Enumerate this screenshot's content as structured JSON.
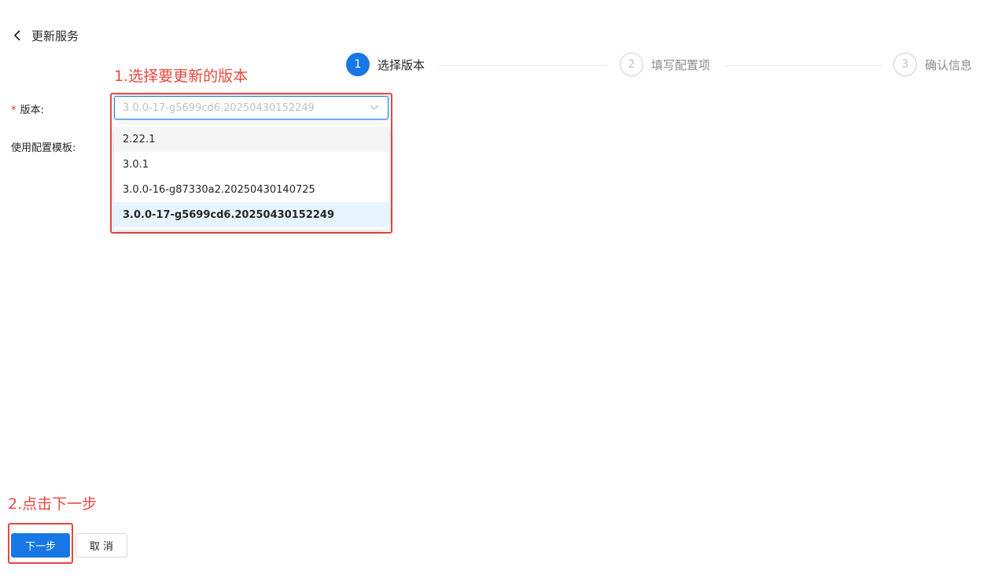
{
  "header": {
    "back_icon": "chevron-left-icon",
    "title": "更新服务"
  },
  "steps": [
    {
      "number": "1",
      "label": "选择版本",
      "state": "active"
    },
    {
      "number": "2",
      "label": "填写配置项",
      "state": "pending"
    },
    {
      "number": "3",
      "label": "确认信息",
      "state": "pending"
    }
  ],
  "annotations": {
    "step1": "1.选择要更新的版本",
    "step2": "2.点击下一步",
    "color": "#e8473d"
  },
  "form": {
    "version_required_mark": "*",
    "version_label": "版本:",
    "template_label": "使用配置模板:",
    "version_select": {
      "value": "3.0.0-17-g5699cd6.20250430152249",
      "arrow_icon": "chevron-down-icon",
      "options": [
        {
          "label": "2.22.1",
          "state": "hover"
        },
        {
          "label": "3.0.1",
          "state": "normal"
        },
        {
          "label": "3.0.0-16-g87330a2.20250430140725",
          "state": "normal"
        },
        {
          "label": "3.0.0-17-g5699cd6.20250430152249",
          "state": "selected"
        }
      ]
    }
  },
  "footer": {
    "next_label": "下一步",
    "cancel_label": "取 消"
  },
  "colors": {
    "primary": "#1677e5",
    "selected_bg": "#e6f4ff"
  }
}
